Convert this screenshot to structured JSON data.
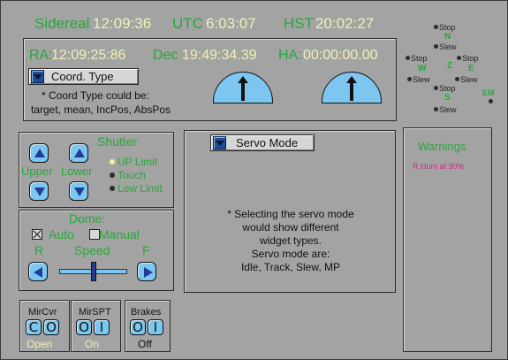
{
  "time": {
    "sidereal_label": "Sidereal",
    "sidereal_value": "12:09:36",
    "utc_label": "UTC",
    "utc_value": "6:03:07",
    "hst_label": "HST",
    "hst_value": "20:02:27"
  },
  "coords": {
    "ra_label": "RA:",
    "ra_value": "12:09:25:86",
    "dec_label": "Dec",
    "dec_value": "19:49:34.39",
    "ha_label": "HA:",
    "ha_value": "00:00:00.00",
    "coord_type_label": "Coord. Type",
    "note_line1": "* Coord Type could be:",
    "note_line2": "target, mean, IncPos, AbsPos"
  },
  "compass": {
    "n_stop": "Stop",
    "n_label": "N",
    "n_slew": "Slew",
    "w_stop": "Stop",
    "w_label": "W",
    "z_label": "Z",
    "e_label": "E",
    "e_stop": "Stop",
    "w_slew": "Slew",
    "e_slew": "Slew",
    "s_stop": "Stop",
    "s_label": "S",
    "s_slew": "Slew",
    "em_label": "EM"
  },
  "shutter": {
    "title": "Shutter",
    "upper_label": "Upper",
    "lower_label": "Lower",
    "up_limit": "UP Limit",
    "touch": "Touch",
    "low_limit": "Low Limit"
  },
  "dome": {
    "title": "Dome:",
    "auto_label": "Auto",
    "manual_label": "Manual",
    "r_label": "R",
    "speed_label": "Speed",
    "f_label": "F",
    "speed_level": 0.5
  },
  "servo": {
    "mode_label": "Servo Mode",
    "note_line1": "* Selecting the servo mode",
    "note_line2": "would show different",
    "note_line3": "widget types.",
    "note_line4": "Servo mode are:",
    "note_line5": "Idle, Track, Slew, MP"
  },
  "warnings": {
    "title": "Warnings",
    "message": "R.Hum at 90%"
  },
  "mircvr": {
    "title": "MirCvr",
    "btn1": "C",
    "btn2": "O",
    "status": "Open"
  },
  "mirspt": {
    "title": "MirSPT",
    "btn1": "O",
    "btn2": "I",
    "status": "On"
  },
  "brakes": {
    "title": "Brakes",
    "btn1": "O",
    "btn2": "I",
    "status": "Off"
  },
  "colors": {
    "green": "#27a83a",
    "yellow": "#f2f0b4",
    "button_blue": "#7cc6ef",
    "warning_magenta": "#e0208a",
    "panel_gray": "#a3a3a3"
  }
}
